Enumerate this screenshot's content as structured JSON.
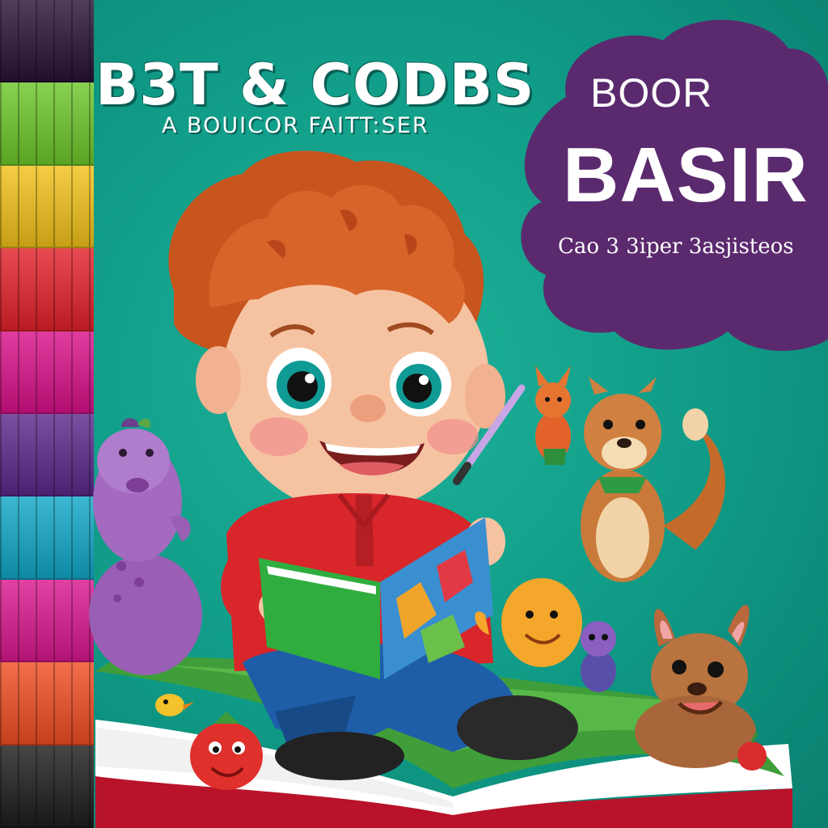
{
  "cover": {
    "title": "B3T & CODBS",
    "subtitle": "A BOUICOR FAITT:SER",
    "badge": {
      "line1": "BOOR",
      "line2": "BASIR",
      "tagline": "Cao 3 3iper 3asjisteos"
    }
  },
  "colors": {
    "background": "#0f9a86",
    "cloud": "#5b2a6e",
    "spine_bands": [
      "#2a1238",
      "#6fc72b",
      "#f2c21b",
      "#e3232b",
      "#d9128a",
      "#5b2a8c",
      "#12a8c8",
      "#d91890",
      "#f04e23",
      "#1e1e1e"
    ]
  },
  "icons": [
    "boy-character",
    "open-book-icon",
    "purple-dinosaur",
    "squirrel-character",
    "fox-character",
    "bunny-character",
    "orange-blob-character",
    "tomato-character",
    "paintbrush-icon",
    "apple-icon"
  ]
}
